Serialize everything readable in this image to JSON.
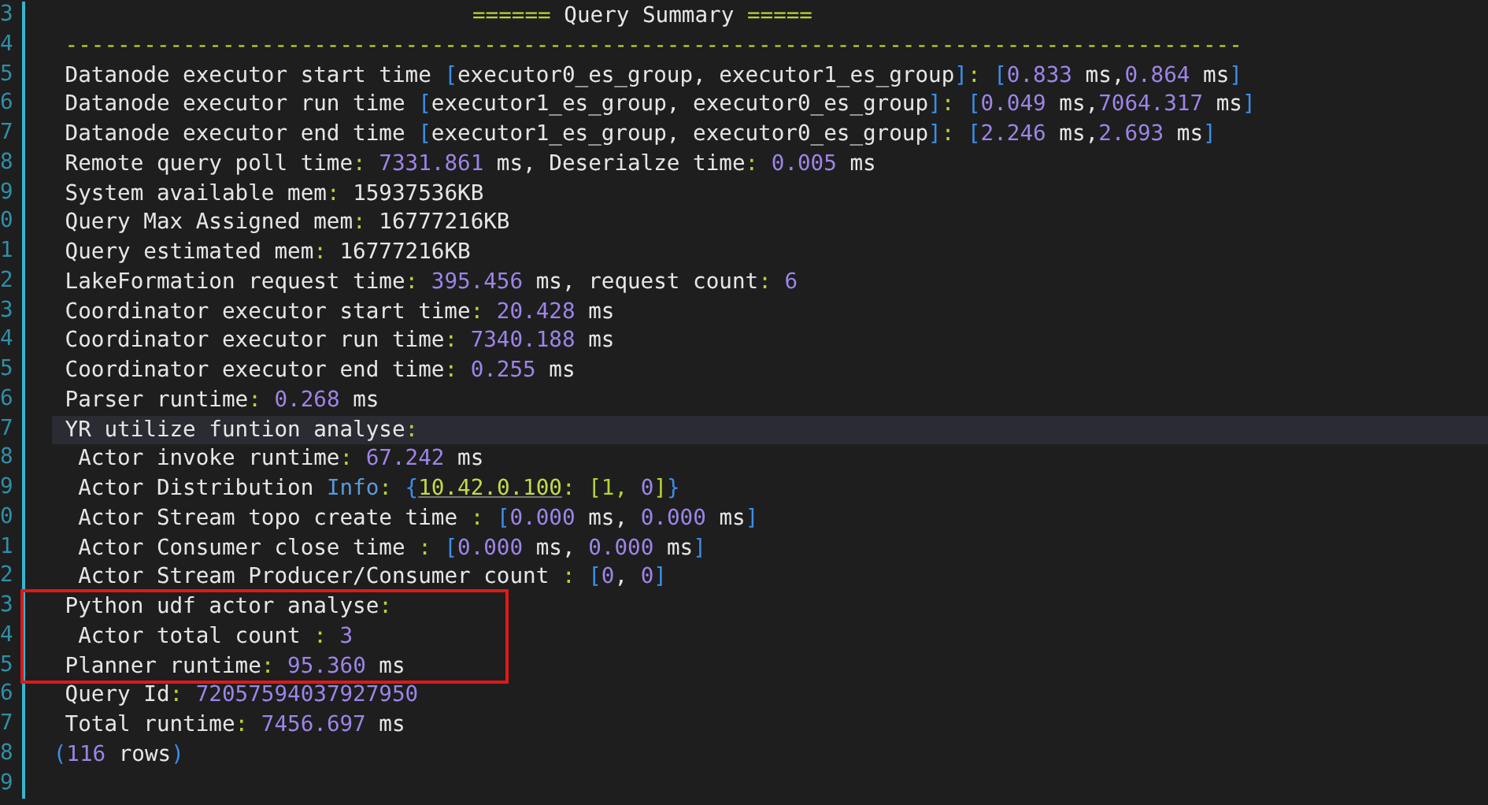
{
  "line_numbers": [
    "3",
    "4",
    "5",
    "6",
    "7",
    "8",
    "9",
    "0",
    "1",
    "2",
    "3",
    "4",
    "5",
    "6",
    "7",
    "8",
    "9",
    "0",
    "1",
    "2",
    "3",
    "4",
    "5",
    "6",
    "7",
    "8",
    "9"
  ],
  "lines": [
    {
      "kind": "header",
      "highlighted": false,
      "boxed": false,
      "segments": [
        {
          "kind": "punct",
          "text": "======"
        },
        {
          "kind": "text",
          "text": " Query Summary "
        },
        {
          "kind": "punct",
          "text": "====="
        }
      ]
    },
    {
      "kind": "rule",
      "highlighted": false,
      "boxed": false,
      "segments": [
        {
          "kind": "punct",
          "text": "------------------------------------------------------------------------------------------"
        }
      ]
    },
    {
      "kind": "item",
      "highlighted": false,
      "boxed": false,
      "segments": [
        {
          "kind": "text",
          "text": "Datanode executor start time "
        },
        {
          "kind": "bracket",
          "text": "["
        },
        {
          "kind": "text",
          "text": "executor0_es_group, executor1_es_group"
        },
        {
          "kind": "bracket",
          "text": "]"
        },
        {
          "kind": "punct",
          "text": ": "
        },
        {
          "kind": "bracket",
          "text": "["
        },
        {
          "kind": "number",
          "text": "0.833"
        },
        {
          "kind": "text",
          "text": " ms,"
        },
        {
          "kind": "number",
          "text": "0.864"
        },
        {
          "kind": "text",
          "text": " ms"
        },
        {
          "kind": "bracket",
          "text": "]"
        }
      ]
    },
    {
      "kind": "item",
      "highlighted": false,
      "boxed": false,
      "segments": [
        {
          "kind": "text",
          "text": "Datanode executor run time "
        },
        {
          "kind": "bracket",
          "text": "["
        },
        {
          "kind": "text",
          "text": "executor1_es_group, executor0_es_group"
        },
        {
          "kind": "bracket",
          "text": "]"
        },
        {
          "kind": "punct",
          "text": ": "
        },
        {
          "kind": "bracket",
          "text": "["
        },
        {
          "kind": "number",
          "text": "0.049"
        },
        {
          "kind": "text",
          "text": " ms,"
        },
        {
          "kind": "number",
          "text": "7064.317"
        },
        {
          "kind": "text",
          "text": " ms"
        },
        {
          "kind": "bracket",
          "text": "]"
        }
      ]
    },
    {
      "kind": "item",
      "highlighted": false,
      "boxed": false,
      "segments": [
        {
          "kind": "text",
          "text": "Datanode executor end time "
        },
        {
          "kind": "bracket",
          "text": "["
        },
        {
          "kind": "text",
          "text": "executor1_es_group, executor0_es_group"
        },
        {
          "kind": "bracket",
          "text": "]"
        },
        {
          "kind": "punct",
          "text": ": "
        },
        {
          "kind": "bracket",
          "text": "["
        },
        {
          "kind": "number",
          "text": "2.246"
        },
        {
          "kind": "text",
          "text": " ms,"
        },
        {
          "kind": "number",
          "text": "2.693"
        },
        {
          "kind": "text",
          "text": " ms"
        },
        {
          "kind": "bracket",
          "text": "]"
        }
      ]
    },
    {
      "kind": "item",
      "highlighted": false,
      "boxed": false,
      "segments": [
        {
          "kind": "text",
          "text": "Remote query poll time"
        },
        {
          "kind": "punct",
          "text": ": "
        },
        {
          "kind": "number",
          "text": "7331.861"
        },
        {
          "kind": "text",
          "text": " ms, Deserialze time"
        },
        {
          "kind": "punct",
          "text": ": "
        },
        {
          "kind": "number",
          "text": "0.005"
        },
        {
          "kind": "text",
          "text": " ms"
        }
      ]
    },
    {
      "kind": "item",
      "highlighted": false,
      "boxed": false,
      "segments": [
        {
          "kind": "text",
          "text": "System available mem"
        },
        {
          "kind": "punct",
          "text": ": "
        },
        {
          "kind": "text",
          "text": "15937536KB"
        }
      ]
    },
    {
      "kind": "item",
      "highlighted": false,
      "boxed": false,
      "segments": [
        {
          "kind": "text",
          "text": "Query Max Assigned mem"
        },
        {
          "kind": "punct",
          "text": ": "
        },
        {
          "kind": "text",
          "text": "16777216KB"
        }
      ]
    },
    {
      "kind": "item",
      "highlighted": false,
      "boxed": false,
      "segments": [
        {
          "kind": "text",
          "text": "Query estimated mem"
        },
        {
          "kind": "punct",
          "text": ": "
        },
        {
          "kind": "text",
          "text": "16777216KB"
        }
      ]
    },
    {
      "kind": "item",
      "highlighted": false,
      "boxed": false,
      "segments": [
        {
          "kind": "text",
          "text": "LakeFormation request time"
        },
        {
          "kind": "punct",
          "text": ": "
        },
        {
          "kind": "number",
          "text": "395.456"
        },
        {
          "kind": "text",
          "text": " ms, request count"
        },
        {
          "kind": "punct",
          "text": ": "
        },
        {
          "kind": "number",
          "text": "6"
        }
      ]
    },
    {
      "kind": "item",
      "highlighted": false,
      "boxed": false,
      "segments": [
        {
          "kind": "text",
          "text": "Coordinator executor start time"
        },
        {
          "kind": "punct",
          "text": ": "
        },
        {
          "kind": "number",
          "text": "20.428"
        },
        {
          "kind": "text",
          "text": " ms"
        }
      ]
    },
    {
      "kind": "item",
      "highlighted": false,
      "boxed": false,
      "segments": [
        {
          "kind": "text",
          "text": "Coordinator executor run time"
        },
        {
          "kind": "punct",
          "text": ": "
        },
        {
          "kind": "number",
          "text": "7340.188"
        },
        {
          "kind": "text",
          "text": " ms"
        }
      ]
    },
    {
      "kind": "item",
      "highlighted": false,
      "boxed": false,
      "segments": [
        {
          "kind": "text",
          "text": "Coordinator executor end time"
        },
        {
          "kind": "punct",
          "text": ": "
        },
        {
          "kind": "number",
          "text": "0.255"
        },
        {
          "kind": "text",
          "text": " ms"
        }
      ]
    },
    {
      "kind": "item",
      "highlighted": false,
      "boxed": false,
      "segments": [
        {
          "kind": "text",
          "text": "Parser runtime"
        },
        {
          "kind": "punct",
          "text": ": "
        },
        {
          "kind": "number",
          "text": "0.268"
        },
        {
          "kind": "text",
          "text": " ms"
        }
      ]
    },
    {
      "kind": "item",
      "highlighted": true,
      "boxed": false,
      "segments": [
        {
          "kind": "text",
          "text": "YR utilize funtion analyse"
        },
        {
          "kind": "punct",
          "text": ":"
        }
      ]
    },
    {
      "kind": "sub",
      "highlighted": false,
      "boxed": false,
      "segments": [
        {
          "kind": "text",
          "text": "Actor invoke runtime"
        },
        {
          "kind": "punct",
          "text": ": "
        },
        {
          "kind": "number",
          "text": "67.242"
        },
        {
          "kind": "text",
          "text": " ms"
        }
      ]
    },
    {
      "kind": "sub",
      "highlighted": false,
      "boxed": false,
      "segments": [
        {
          "kind": "text",
          "text": "Actor Distribution "
        },
        {
          "kind": "keyword",
          "text": "Info"
        },
        {
          "kind": "punct",
          "text": ": "
        },
        {
          "kind": "bracket",
          "text": "{"
        },
        {
          "kind": "link",
          "text": "10.42.0.100"
        },
        {
          "kind": "punct",
          "text": ": [1, "
        },
        {
          "kind": "number",
          "text": "0"
        },
        {
          "kind": "punct",
          "text": "]"
        },
        {
          "kind": "bracket",
          "text": "}"
        }
      ]
    },
    {
      "kind": "sub",
      "highlighted": false,
      "boxed": false,
      "segments": [
        {
          "kind": "text",
          "text": "Actor Stream topo create time "
        },
        {
          "kind": "punct",
          "text": ": "
        },
        {
          "kind": "bracket",
          "text": "["
        },
        {
          "kind": "number",
          "text": "0.000"
        },
        {
          "kind": "text",
          "text": " ms, "
        },
        {
          "kind": "number",
          "text": "0.000"
        },
        {
          "kind": "text",
          "text": " ms"
        },
        {
          "kind": "bracket",
          "text": "]"
        }
      ]
    },
    {
      "kind": "sub",
      "highlighted": false,
      "boxed": false,
      "segments": [
        {
          "kind": "text",
          "text": "Actor Consumer close time "
        },
        {
          "kind": "punct",
          "text": ": "
        },
        {
          "kind": "bracket",
          "text": "["
        },
        {
          "kind": "number",
          "text": "0.000"
        },
        {
          "kind": "text",
          "text": " ms, "
        },
        {
          "kind": "number",
          "text": "0.000"
        },
        {
          "kind": "text",
          "text": " ms"
        },
        {
          "kind": "bracket",
          "text": "]"
        }
      ]
    },
    {
      "kind": "sub",
      "highlighted": false,
      "boxed": false,
      "segments": [
        {
          "kind": "text",
          "text": "Actor Stream Producer/Consumer count "
        },
        {
          "kind": "punct",
          "text": ": "
        },
        {
          "kind": "bracket",
          "text": "["
        },
        {
          "kind": "number",
          "text": "0"
        },
        {
          "kind": "text",
          "text": ", "
        },
        {
          "kind": "number",
          "text": "0"
        },
        {
          "kind": "bracket",
          "text": "]"
        }
      ]
    },
    {
      "kind": "item",
      "highlighted": false,
      "boxed": true,
      "segments": [
        {
          "kind": "text",
          "text": "Python udf actor analyse"
        },
        {
          "kind": "punct",
          "text": ":"
        }
      ]
    },
    {
      "kind": "sub",
      "highlighted": false,
      "boxed": true,
      "segments": [
        {
          "kind": "text",
          "text": "Actor total count "
        },
        {
          "kind": "punct",
          "text": ": "
        },
        {
          "kind": "number",
          "text": "3"
        }
      ]
    },
    {
      "kind": "item",
      "highlighted": false,
      "boxed": true,
      "segments": [
        {
          "kind": "text",
          "text": "Planner runtime"
        },
        {
          "kind": "punct",
          "text": ": "
        },
        {
          "kind": "number",
          "text": "95.360"
        },
        {
          "kind": "text",
          "text": " ms"
        }
      ]
    },
    {
      "kind": "item",
      "highlighted": false,
      "boxed": false,
      "segments": [
        {
          "kind": "text",
          "text": "Query Id"
        },
        {
          "kind": "punct",
          "text": ": "
        },
        {
          "kind": "number",
          "text": "72057594037927950"
        }
      ]
    },
    {
      "kind": "item",
      "highlighted": false,
      "boxed": false,
      "segments": [
        {
          "kind": "text",
          "text": "Total runtime"
        },
        {
          "kind": "punct",
          "text": ": "
        },
        {
          "kind": "number",
          "text": "7456.697"
        },
        {
          "kind": "text",
          "text": " ms"
        }
      ]
    },
    {
      "kind": "footer",
      "highlighted": false,
      "boxed": false,
      "segments": [
        {
          "kind": "bracket",
          "text": "("
        },
        {
          "kind": "number",
          "text": "116"
        },
        {
          "kind": "text",
          "text": " rows"
        },
        {
          "kind": "bracket",
          "text": ")"
        }
      ]
    }
  ]
}
